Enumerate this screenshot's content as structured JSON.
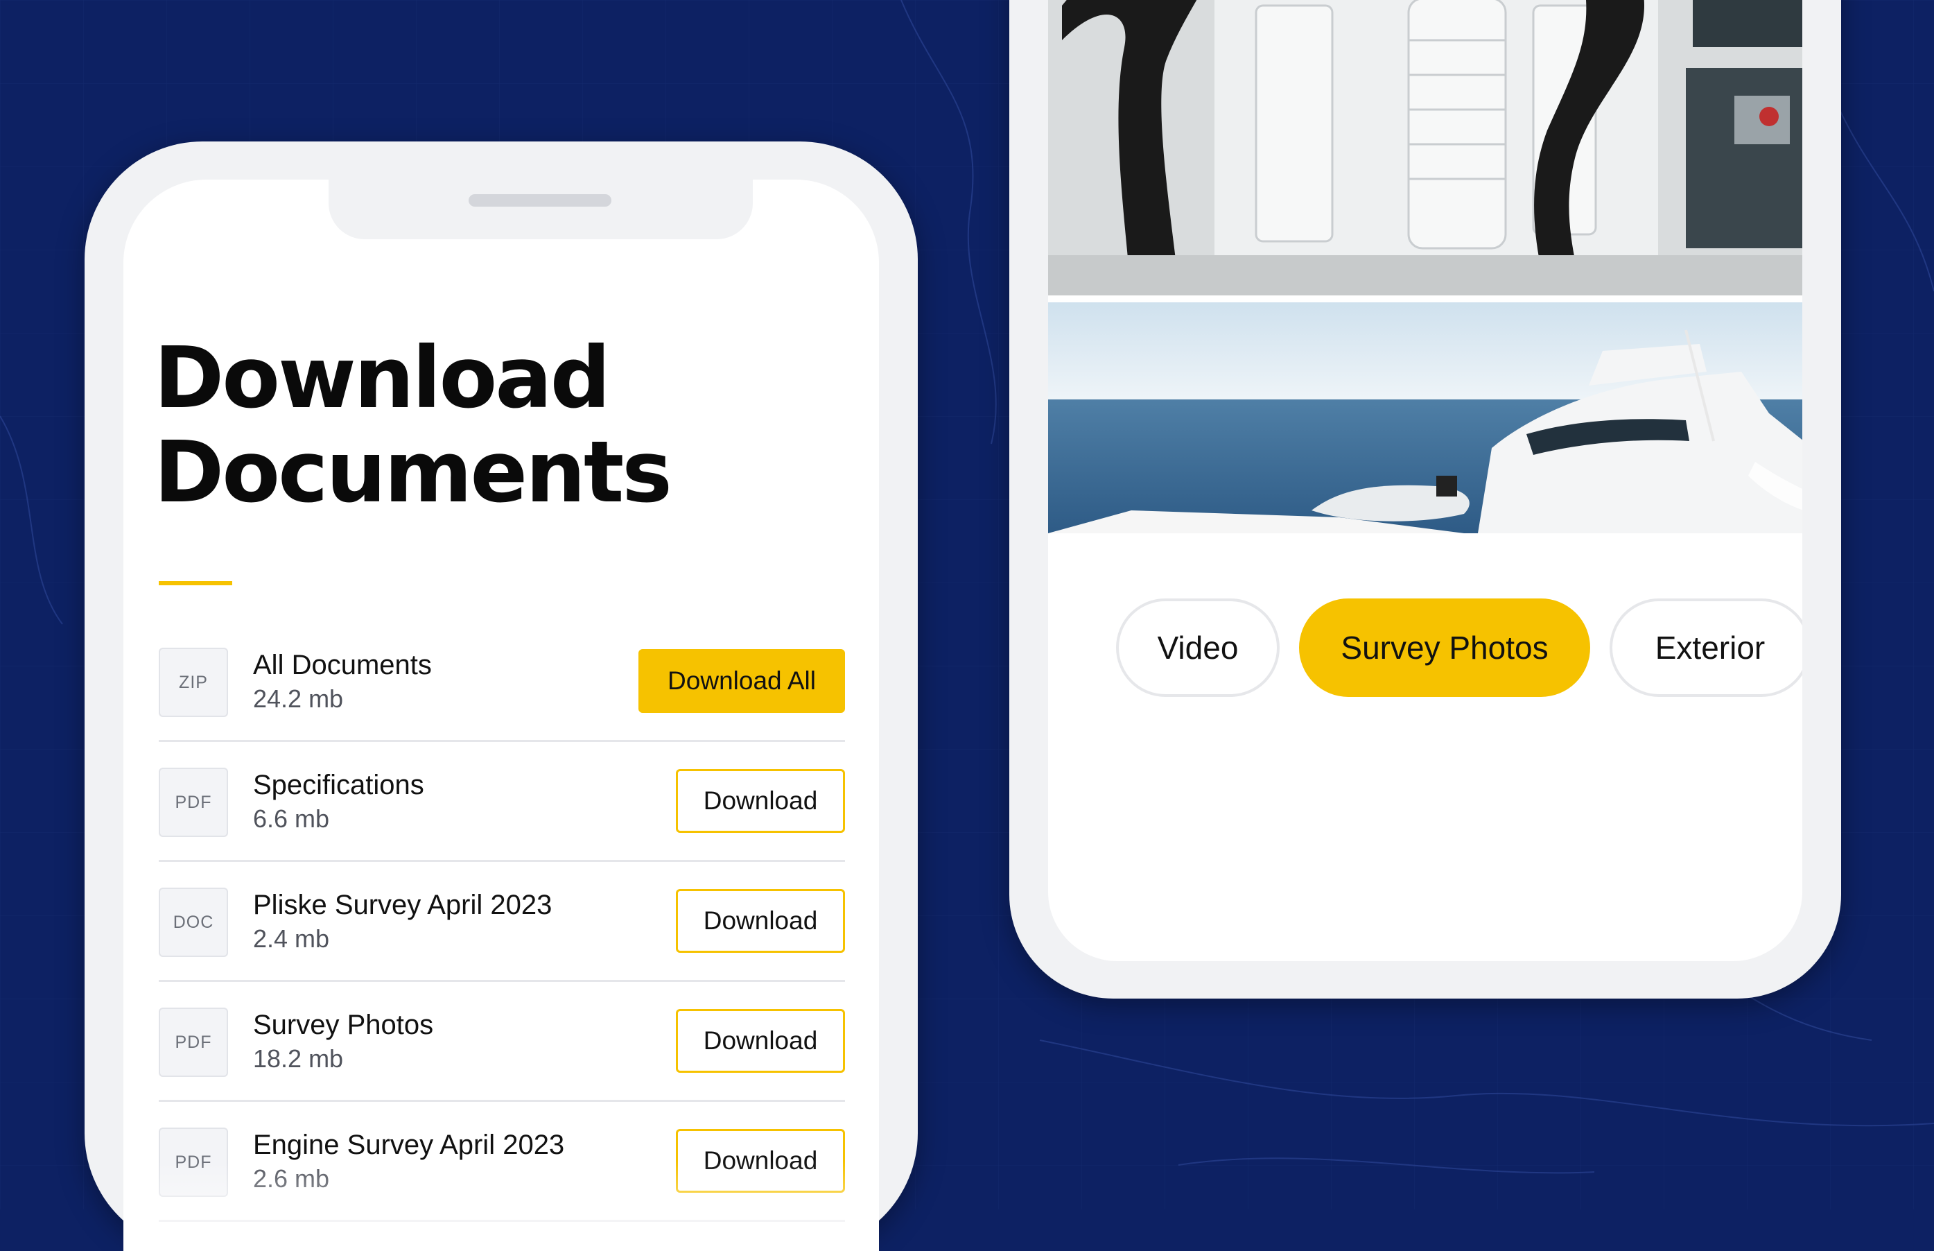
{
  "colors": {
    "background": "#0d2163",
    "accent": "#f6c200",
    "phone_frame": "#f1f2f4"
  },
  "documents_screen": {
    "title_line1": "Download",
    "title_line2": "Documents",
    "items": [
      {
        "type": "ZIP",
        "name": "All Documents",
        "size": "24.2 mb",
        "action": "Download All",
        "primary": true
      },
      {
        "type": "PDF",
        "name": "Specifications",
        "size": "6.6 mb",
        "action": "Download",
        "primary": false
      },
      {
        "type": "DOC",
        "name": "Pliske Survey April 2023",
        "size": "2.4 mb",
        "action": "Download",
        "primary": false
      },
      {
        "type": "PDF",
        "name": "Survey Photos",
        "size": "18.2 mb",
        "action": "Download",
        "primary": false
      },
      {
        "type": "PDF",
        "name": "Engine Survey April 2023",
        "size": "2.6 mb",
        "action": "Download",
        "primary": false
      }
    ]
  },
  "gallery_screen": {
    "tabs": [
      {
        "label": "Video",
        "active": false
      },
      {
        "label": "Survey Photos",
        "active": true
      },
      {
        "label": "Exterior",
        "active": false
      }
    ]
  }
}
